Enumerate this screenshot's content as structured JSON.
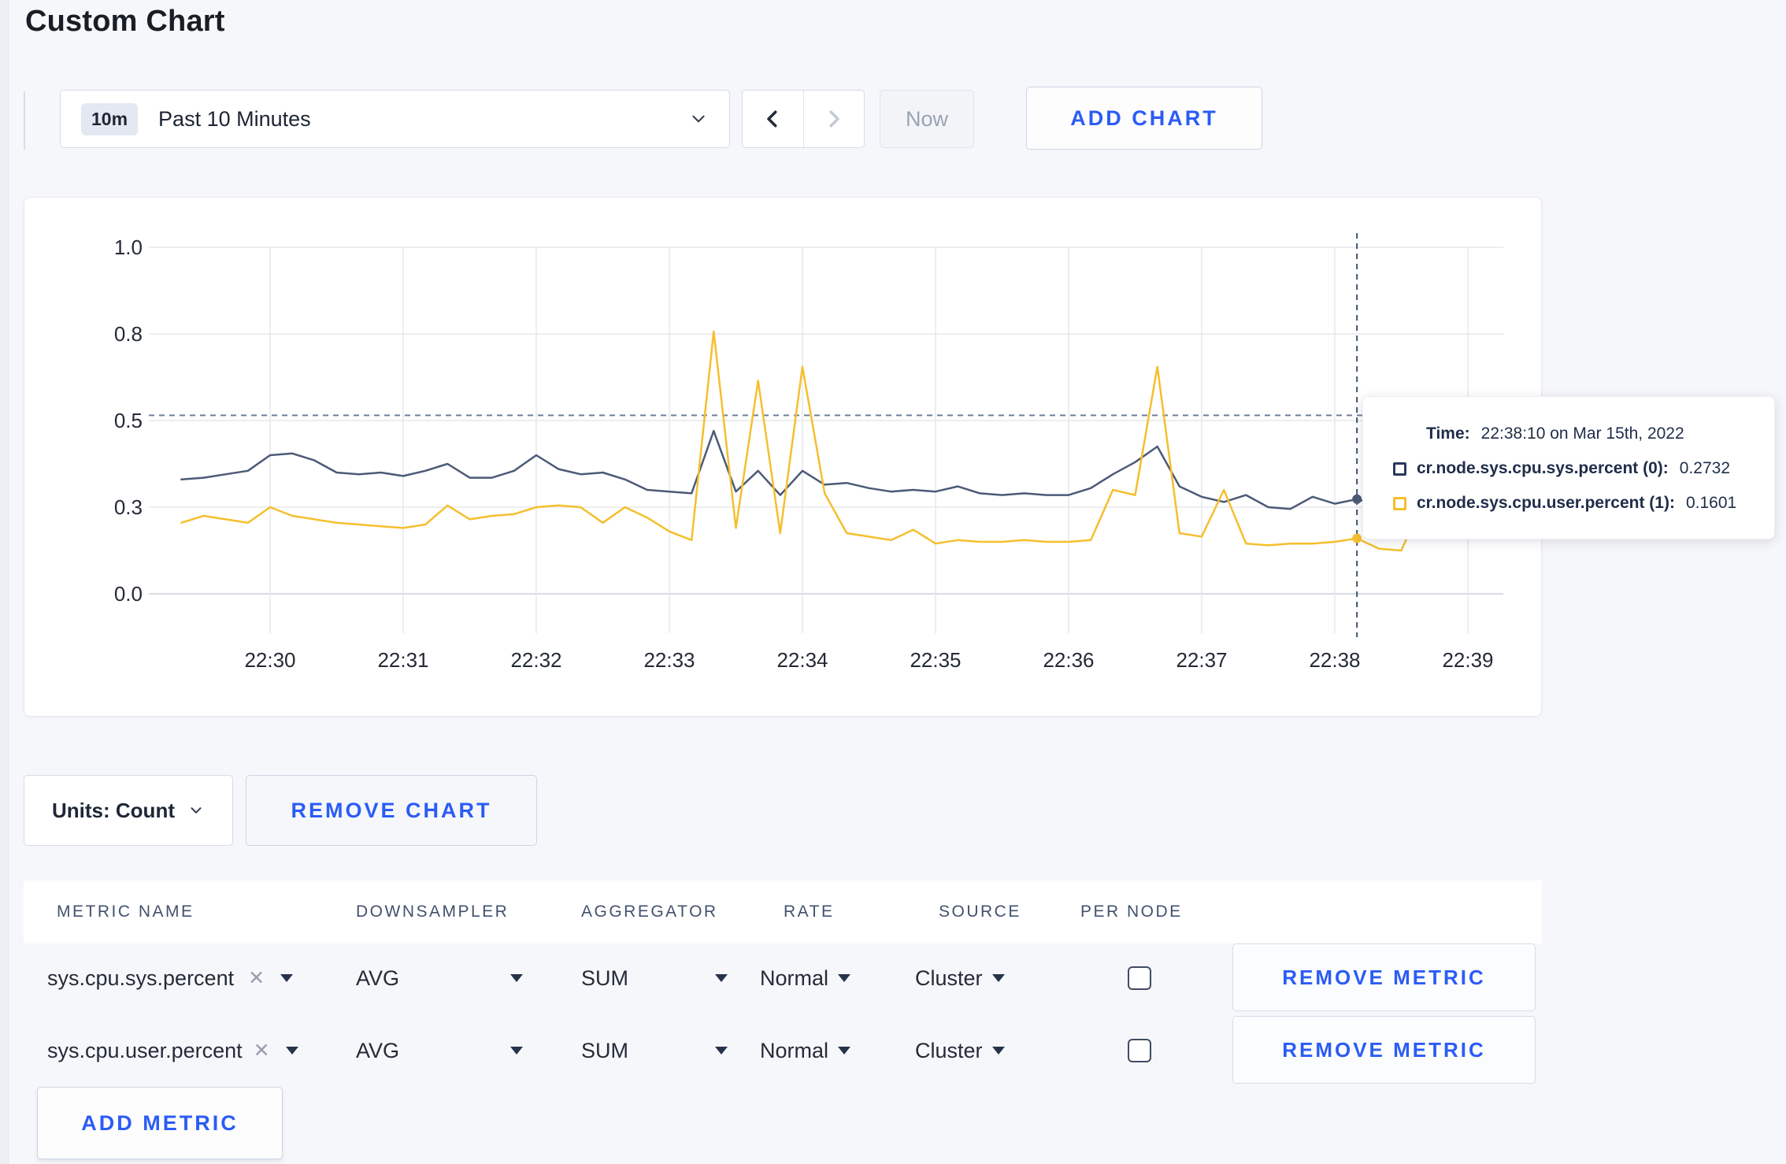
{
  "page": {
    "title": "Custom Chart"
  },
  "toolbar": {
    "time_badge": "10m",
    "time_label": "Past 10 Minutes",
    "prev_label": "previous time window",
    "next_label": "next time window",
    "now_label": "Now",
    "add_chart_label": "ADD CHART"
  },
  "colors": {
    "accent_blue": "#2b5cf6",
    "series_sys": "#4c5a77",
    "series_user": "#f5bf2d",
    "crosshair": "#3f536f",
    "guide_line": "#6f7f9d",
    "gridline": "#e7e8ec"
  },
  "chart": {
    "tooltip": {
      "time_label": "Time:",
      "time_value": "22:38:10 on Mar 15th, 2022",
      "rows": [
        {
          "name": "cr.node.sys.cpu.sys.percent (0):",
          "value": "0.2732",
          "swatch_color": "#2a3a5c"
        },
        {
          "name": "cr.node.sys.cpu.user.percent (1):",
          "value": "0.1601",
          "swatch_color": "#f5bf2d"
        }
      ]
    }
  },
  "chart_data": {
    "type": "line",
    "title": "",
    "xlabel": "",
    "ylabel": "",
    "ylim": [
      0,
      1
    ],
    "grid": true,
    "legend_position": "tooltip",
    "y_tick_labels": [
      "0.0",
      "0.3",
      "0.5",
      "0.8",
      "1.0"
    ],
    "y_tick_values": [
      0,
      0.25,
      0.5,
      0.75,
      1.0
    ],
    "x_ticks": [
      "22:30",
      "22:31",
      "22:32",
      "22:33",
      "22:34",
      "22:35",
      "22:36",
      "22:37",
      "22:38",
      "22:39"
    ],
    "x_start": "22:29:20",
    "x_step_seconds": 10,
    "x_tick_first_index": 4,
    "x_tick_every": 6,
    "guide_line_y": 0.515,
    "crosshair": {
      "index": 53,
      "time": "22:38:10 on Mar 15th, 2022"
    },
    "series": [
      {
        "name": "cr.node.sys.cpu.sys.percent",
        "color": "#4c5a77",
        "values": [
          0.33,
          0.335,
          0.345,
          0.355,
          0.4,
          0.405,
          0.385,
          0.35,
          0.345,
          0.35,
          0.34,
          0.355,
          0.375,
          0.335,
          0.335,
          0.355,
          0.4,
          0.36,
          0.345,
          0.35,
          0.33,
          0.3,
          0.295,
          0.29,
          0.47,
          0.295,
          0.355,
          0.285,
          0.355,
          0.315,
          0.32,
          0.305,
          0.295,
          0.3,
          0.295,
          0.31,
          0.29,
          0.285,
          0.29,
          0.285,
          0.285,
          0.305,
          0.345,
          0.38,
          0.425,
          0.31,
          0.28,
          0.265,
          0.285,
          0.25,
          0.245,
          0.28,
          0.26,
          0.2732,
          0.255,
          0.305,
          0.275,
          0.285,
          0.295,
          0.31
        ]
      },
      {
        "name": "cr.node.sys.cpu.user.percent",
        "color": "#f5bf2d",
        "values": [
          0.205,
          0.225,
          0.215,
          0.205,
          0.25,
          0.225,
          0.215,
          0.205,
          0.2,
          0.195,
          0.19,
          0.2,
          0.255,
          0.215,
          0.225,
          0.23,
          0.25,
          0.255,
          0.25,
          0.205,
          0.25,
          0.22,
          0.18,
          0.155,
          0.757,
          0.19,
          0.615,
          0.175,
          0.655,
          0.29,
          0.175,
          0.165,
          0.155,
          0.185,
          0.145,
          0.155,
          0.15,
          0.15,
          0.155,
          0.15,
          0.15,
          0.155,
          0.3,
          0.285,
          0.655,
          0.175,
          0.165,
          0.3,
          0.145,
          0.14,
          0.145,
          0.145,
          0.15,
          0.1601,
          0.13,
          0.125,
          0.27,
          0.22,
          0.245,
          0.265
        ]
      }
    ]
  },
  "units": {
    "label": "Units: Count",
    "remove_chart_label": "REMOVE CHART"
  },
  "metrics_table": {
    "headers": [
      "METRIC NAME",
      "DOWNSAMPLER",
      "AGGREGATOR",
      "RATE",
      "SOURCE",
      "PER NODE"
    ],
    "rows": [
      {
        "metric": "sys.cpu.sys.percent",
        "downsampler": "AVG",
        "aggregator": "SUM",
        "rate": "Normal",
        "source": "Cluster",
        "per_node": false,
        "remove_label": "REMOVE METRIC"
      },
      {
        "metric": "sys.cpu.user.percent",
        "downsampler": "AVG",
        "aggregator": "SUM",
        "rate": "Normal",
        "source": "Cluster",
        "per_node": false,
        "remove_label": "REMOVE METRIC"
      }
    ],
    "add_metric_label": "ADD METRIC"
  }
}
